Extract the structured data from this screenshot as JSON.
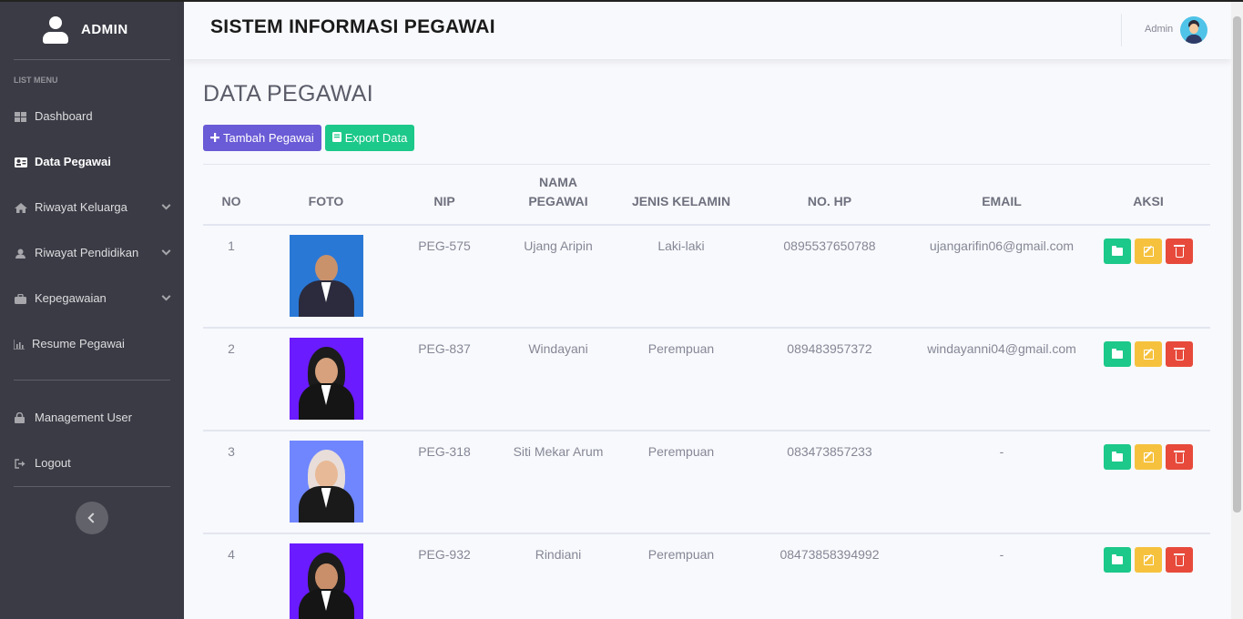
{
  "sidebar": {
    "brand": "ADMIN",
    "heading": "LIST MENU",
    "items": [
      {
        "label": "Dashboard",
        "icon": "dashboard-icon",
        "active": false,
        "submenu": false
      },
      {
        "label": "Data Pegawai",
        "icon": "id-card-icon",
        "active": true,
        "submenu": false
      },
      {
        "label": "Riwayat Keluarga",
        "icon": "home-icon",
        "active": false,
        "submenu": true
      },
      {
        "label": "Riwayat Pendidikan",
        "icon": "graduate-icon",
        "active": false,
        "submenu": true
      },
      {
        "label": "Kepegawaian",
        "icon": "briefcase-icon",
        "active": false,
        "submenu": true
      },
      {
        "label": "Resume Pegawai",
        "icon": "chart-icon",
        "active": false,
        "submenu": false
      }
    ],
    "bottom_items": [
      {
        "label": "Management User",
        "icon": "lock-icon"
      },
      {
        "label": "Logout",
        "icon": "sign-out-icon"
      }
    ]
  },
  "topbar": {
    "title": "SISTEM INFORMASI PEGAWAI",
    "user": "Admin"
  },
  "main": {
    "page_title": "DATA PEGAWAI",
    "add_button": "Tambah Pegawai",
    "export_button": "Export Data",
    "table": {
      "headers": [
        "NO",
        "FOTO",
        "NIP",
        "NAMA PEGAWAI",
        "JENIS KELAMIN",
        "NO. HP",
        "EMAIL",
        "AKSI"
      ],
      "rows": [
        {
          "no": "1",
          "nip": "PEG-575",
          "nama": "Ujang Aripin",
          "jk": "Laki-laki",
          "hp": "0895537650788",
          "email": "ujangarifin06@gmail.com",
          "photo_bg": "#2a78d6"
        },
        {
          "no": "2",
          "nip": "PEG-837",
          "nama": "Windayani",
          "jk": "Perempuan",
          "hp": "089483957372",
          "email": "windayanni04@gmail.com",
          "photo_bg": "#6a1bff"
        },
        {
          "no": "3",
          "nip": "PEG-318",
          "nama": "Siti Mekar Arum",
          "jk": "Perempuan",
          "hp": "083473857233",
          "email": "-",
          "photo_bg": "#6f86ff"
        },
        {
          "no": "4",
          "nip": "PEG-932",
          "nama": "Rindiani",
          "jk": "Perempuan",
          "hp": "08473858394992",
          "email": "-",
          "photo_bg": "#6a1bff"
        }
      ]
    }
  },
  "colors": {
    "sidebar_bg": "#3a3b45",
    "primary": "#6a5bd6",
    "success": "#1cc88a",
    "warning": "#f6c23e",
    "danger": "#e74a3b"
  }
}
